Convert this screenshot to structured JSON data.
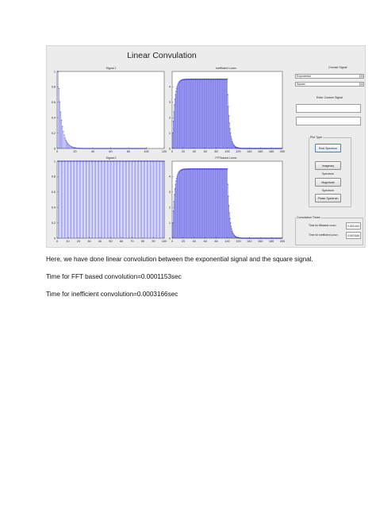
{
  "gui": {
    "title": "Linear Convulation",
    "choose_signal_label": "Choose Signal",
    "signal1_select": "Exponential",
    "signal2_select": "Square",
    "custom_signal_label": "Enter Custom Signal",
    "plot_type_label": "Plot Type",
    "buttons": {
      "real": "Real Spectrum",
      "imaginary": "Imaginary Spectrum",
      "magnitude": "Magnitude Spectrum",
      "phase": "Phase Spectrum"
    },
    "conv_times": {
      "panel_label": "Convulation Times",
      "fft_label": "Time for fftbased conv=",
      "fft_value": "0.0001153",
      "ineff_label": "Time for inefficient conv=",
      "ineff_value": "0.0003166"
    },
    "plot_color": "#1a1ad8",
    "panel_bg": "#ececec"
  },
  "chart_data": [
    {
      "type": "stem",
      "title": "Signal 1",
      "xlim": [
        0,
        120
      ],
      "ylim": [
        0,
        1
      ],
      "xticks": [
        "0",
        "20",
        "40",
        "60",
        "80",
        "100",
        "120"
      ],
      "yticks": [
        "0",
        "0.2",
        "0.4",
        "0.6",
        "0.8",
        "1"
      ],
      "series": [
        {
          "kind": "exponential",
          "x_range": [
            1,
            100
          ],
          "y0": 1,
          "decay": 0.25
        }
      ]
    },
    {
      "type": "stem",
      "title": "Inefficient Lconv",
      "xlim": [
        0,
        200
      ],
      "ylim": [
        0,
        5
      ],
      "xticks": [
        "0",
        "20",
        "40",
        "60",
        "80",
        "100",
        "120",
        "140",
        "160",
        "180",
        "200"
      ],
      "yticks": [
        "0",
        "1",
        "2",
        "3",
        "4"
      ],
      "series": [
        {
          "kind": "convolution",
          "x_range": [
            1,
            199
          ],
          "plateau": 4.5,
          "rise_rate": 0.25,
          "fall_start": 100
        }
      ]
    },
    {
      "type": "stem",
      "title": "Signal 2",
      "xlim": [
        0,
        100
      ],
      "ylim": [
        0,
        1
      ],
      "xticks": [
        "0",
        "10",
        "20",
        "30",
        "40",
        "50",
        "60",
        "70",
        "80",
        "90",
        "100"
      ],
      "yticks": [
        "0",
        "0.2",
        "0.4",
        "0.6",
        "0.8",
        "1"
      ],
      "series": [
        {
          "kind": "constant",
          "x_range": [
            1,
            100
          ],
          "value": 1
        }
      ]
    },
    {
      "type": "stem",
      "title": "FFTbased Lconv",
      "xlim": [
        0,
        200
      ],
      "ylim": [
        0,
        5
      ],
      "xticks": [
        "0",
        "20",
        "40",
        "60",
        "80",
        "100",
        "120",
        "140",
        "160",
        "180",
        "200"
      ],
      "yticks": [
        "0",
        "1",
        "2",
        "3",
        "4"
      ],
      "series": [
        {
          "kind": "convolution",
          "x_range": [
            1,
            199
          ],
          "plateau": 4.5,
          "rise_rate": 0.25,
          "fall_start": 100
        }
      ]
    }
  ],
  "document": {
    "line1": "Here, we have done linear convolution between the exponential signal and the square signal.",
    "line2": "Time for FFT based convolution=0.0001153sec",
    "line3": "Time for inefficient convolution=0.0003166sec"
  }
}
